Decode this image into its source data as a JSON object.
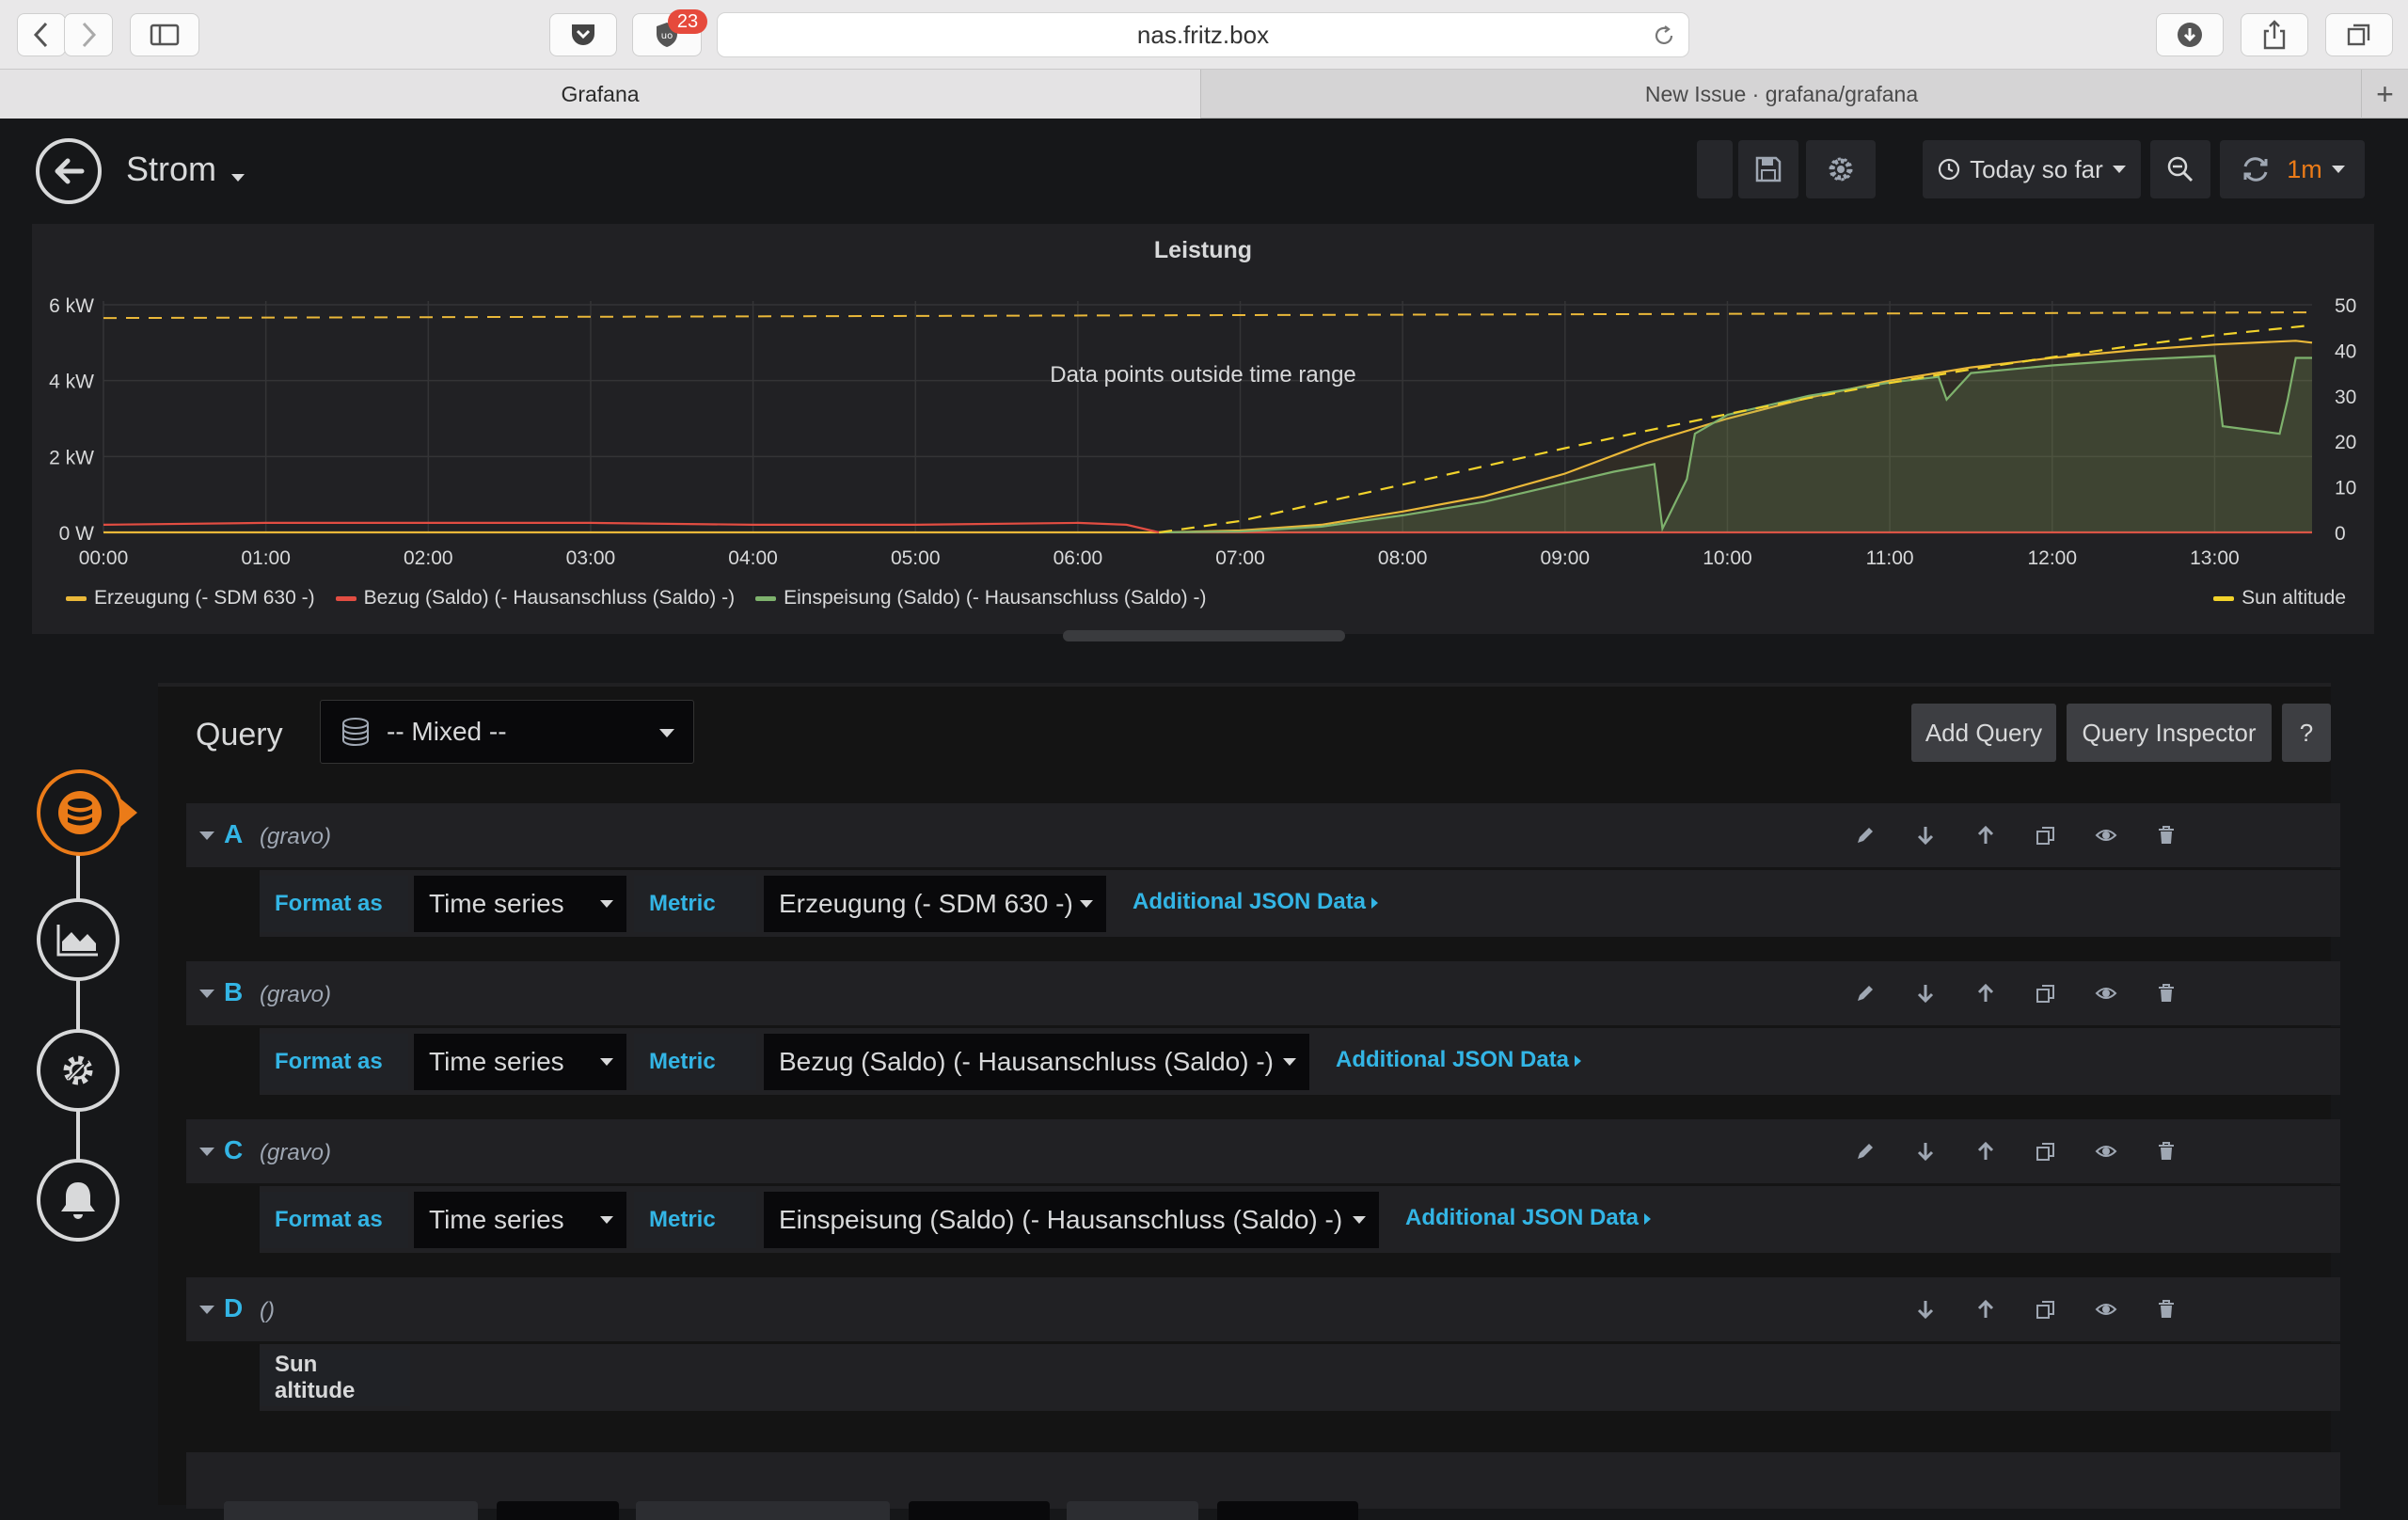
{
  "browser": {
    "url": "nas.fritz.box",
    "ublock_count": "23",
    "tabs": [
      {
        "label": "Grafana"
      },
      {
        "label": "New Issue · grafana/grafana"
      }
    ],
    "new_tab_symbol": "+"
  },
  "dashboard": {
    "title": "Strom",
    "time_range": "Today so far",
    "refresh_interval": "1m"
  },
  "panel": {
    "title": "Leistung",
    "annotation": "Data points outside time range"
  },
  "chart_data": {
    "type": "line",
    "title": "Leistung",
    "x_ticks": [
      "00:00",
      "01:00",
      "02:00",
      "03:00",
      "04:00",
      "05:00",
      "06:00",
      "07:00",
      "08:00",
      "09:00",
      "10:00",
      "11:00",
      "12:00",
      "13:00"
    ],
    "y_left_ticks": [
      "0 W",
      "2 kW",
      "4 kW",
      "6 kW"
    ],
    "y_left_range": [
      0,
      6
    ],
    "y_right_ticks": [
      "0",
      "10",
      "20",
      "30",
      "40",
      "50"
    ],
    "y_right_range": [
      0,
      50
    ],
    "x_range_hours": [
      0,
      13.6
    ],
    "grid": true,
    "legend_position": "bottom",
    "series": [
      {
        "name": "Erzeugung (- SDM 630 -)",
        "color": "#eab839",
        "axis": "left",
        "x": [
          0,
          6,
          6.5,
          7,
          7.5,
          8,
          8.5,
          9,
          9.5,
          10,
          10.5,
          11,
          11.5,
          12,
          12.5,
          13,
          13.5,
          13.6
        ],
        "y": [
          0,
          0,
          0,
          0.05,
          0.2,
          0.55,
          0.95,
          1.55,
          2.35,
          3.0,
          3.55,
          4.0,
          4.35,
          4.6,
          4.8,
          4.95,
          5.05,
          5.0
        ]
      },
      {
        "name": "Bezug (Saldo) (- Hausanschluss (Saldo) -)",
        "color": "#e24d42",
        "axis": "left",
        "x": [
          0,
          1,
          2,
          3,
          4,
          5,
          6,
          6.3,
          6.5,
          13.6
        ],
        "y": [
          0.2,
          0.25,
          0.25,
          0.25,
          0.2,
          0.2,
          0.25,
          0.2,
          0.0,
          0.0
        ]
      },
      {
        "name": "Einspeisung (Saldo) (- Hausanschluss (Saldo) -)",
        "color": "#7eb26d",
        "axis": "left",
        "x": [
          6.5,
          7,
          7.5,
          8,
          8.5,
          9,
          9.3,
          9.55,
          9.6,
          9.75,
          9.8,
          10,
          10.5,
          11,
          11.3,
          11.35,
          11.5,
          12,
          12.5,
          13,
          13.05,
          13.4,
          13.45,
          13.5,
          13.6
        ],
        "y": [
          0,
          0.02,
          0.15,
          0.45,
          0.8,
          1.3,
          1.6,
          1.8,
          0.1,
          1.4,
          2.6,
          3.1,
          3.6,
          3.95,
          4.1,
          3.5,
          4.2,
          4.4,
          4.55,
          4.65,
          2.8,
          2.6,
          3.5,
          4.6,
          4.6
        ]
      },
      {
        "name": "Sun altitude",
        "color": "#f2d32b",
        "axis": "right",
        "dashed": true,
        "x": [
          6.5,
          7,
          7.5,
          8,
          8.5,
          9,
          9.5,
          10,
          10.5,
          11,
          11.5,
          12,
          12.5,
          13,
          13.6
        ],
        "y": [
          0,
          2.5,
          6.5,
          10.5,
          14.5,
          18.5,
          22.3,
          26,
          29.5,
          32.8,
          35.8,
          38.5,
          41,
          43.3,
          45.5
        ]
      }
    ],
    "threshold_line": {
      "value_kw": 5.7,
      "color": "#eab839",
      "dashed": true
    }
  },
  "query_editor": {
    "query_label": "Query",
    "datasource": "-- Mixed --",
    "add_query": "Add Query",
    "query_inspector": "Query Inspector",
    "help": "?",
    "queries": [
      {
        "letter": "A",
        "datasource": "(gravo)",
        "format_label": "Format as",
        "format_value": "Time series",
        "metric_label": "Metric",
        "metric_value": "Erzeugung (- SDM 630 -)",
        "json_link": "Additional JSON Data"
      },
      {
        "letter": "B",
        "datasource": "(gravo)",
        "format_label": "Format as",
        "format_value": "Time series",
        "metric_label": "Metric",
        "metric_value": "Bezug (Saldo) (- Hausanschluss (Saldo) -)",
        "json_link": "Additional JSON Data"
      },
      {
        "letter": "C",
        "datasource": "(gravo)",
        "format_label": "Format as",
        "format_value": "Time series",
        "metric_label": "Metric",
        "metric_value": "Einspeisung (Saldo) (- Hausanschluss (Saldo) -)",
        "json_link": "Additional JSON Data"
      },
      {
        "letter": "D",
        "datasource": "()",
        "body_label": "Sun altitude"
      }
    ]
  }
}
